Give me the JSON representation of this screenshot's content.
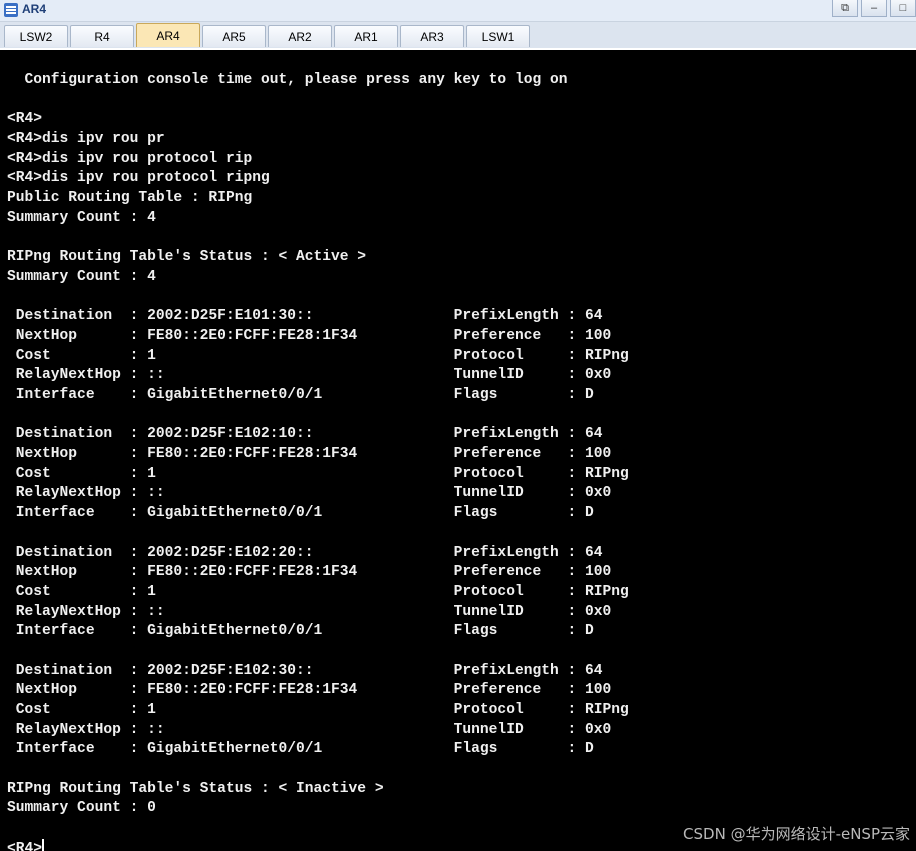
{
  "window": {
    "title": "AR4",
    "controls": [
      "⧉",
      "–",
      "□"
    ]
  },
  "tabs": [
    {
      "label": "LSW2",
      "active": false
    },
    {
      "label": "R4",
      "active": false
    },
    {
      "label": "AR4",
      "active": true
    },
    {
      "label": "AR5",
      "active": false
    },
    {
      "label": "AR2",
      "active": false
    },
    {
      "label": "AR1",
      "active": false
    },
    {
      "label": "AR3",
      "active": false
    },
    {
      "label": "LSW1",
      "active": false
    }
  ],
  "terminal": {
    "lines": [
      "  Configuration console time out, please press any key to log on",
      "",
      "<R4>",
      "<R4>dis ipv rou pr",
      "<R4>dis ipv rou protocol rip",
      "<R4>dis ipv rou protocol ripng",
      "Public Routing Table : RIPng",
      "Summary Count : 4",
      "",
      "RIPng Routing Table's Status : < Active >",
      "Summary Count : 4",
      "",
      " Destination  : 2002:D25F:E101:30::                PrefixLength : 64",
      " NextHop      : FE80::2E0:FCFF:FE28:1F34           Preference   : 100",
      " Cost         : 1                                  Protocol     : RIPng",
      " RelayNextHop : ::                                 TunnelID     : 0x0",
      " Interface    : GigabitEthernet0/0/1               Flags        : D",
      "",
      " Destination  : 2002:D25F:E102:10::                PrefixLength : 64",
      " NextHop      : FE80::2E0:FCFF:FE28:1F34           Preference   : 100",
      " Cost         : 1                                  Protocol     : RIPng",
      " RelayNextHop : ::                                 TunnelID     : 0x0",
      " Interface    : GigabitEthernet0/0/1               Flags        : D",
      "",
      " Destination  : 2002:D25F:E102:20::                PrefixLength : 64",
      " NextHop      : FE80::2E0:FCFF:FE28:1F34           Preference   : 100",
      " Cost         : 1                                  Protocol     : RIPng",
      " RelayNextHop : ::                                 TunnelID     : 0x0",
      " Interface    : GigabitEthernet0/0/1               Flags        : D",
      "",
      " Destination  : 2002:D25F:E102:30::                PrefixLength : 64",
      " NextHop      : FE80::2E0:FCFF:FE28:1F34           Preference   : 100",
      " Cost         : 1                                  Protocol     : RIPng",
      " RelayNextHop : ::                                 TunnelID     : 0x0",
      " Interface    : GigabitEthernet0/0/1               Flags        : D",
      "",
      "RIPng Routing Table's Status : < Inactive >",
      "Summary Count : 0",
      "",
      "<R4>"
    ]
  },
  "watermark": "CSDN @华为网络设计-eNSP云家"
}
